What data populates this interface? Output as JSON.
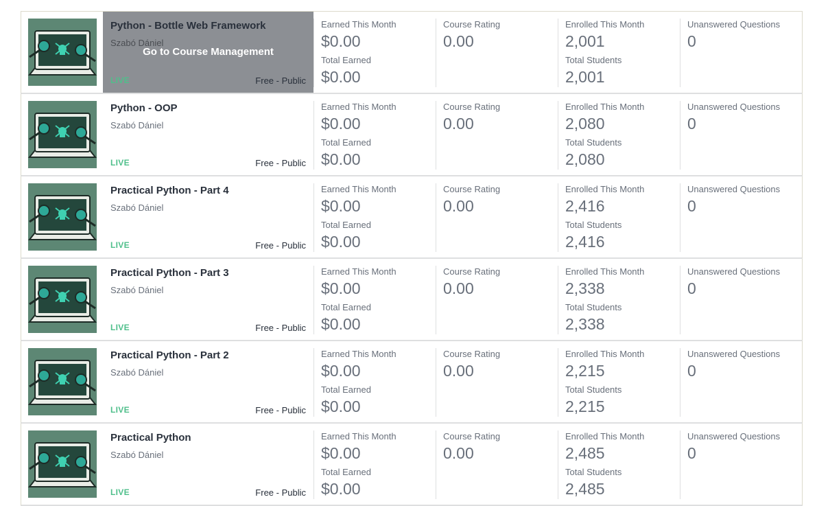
{
  "labels": {
    "earned_month": "Earned This Month",
    "total_earned": "Total Earned",
    "course_rating": "Course Rating",
    "enrolled_month": "Enrolled This Month",
    "total_students": "Total Students",
    "unanswered": "Unanswered Questions",
    "go_to_management": "Go to Course Management"
  },
  "colors": {
    "live": "#4fbf8b",
    "thumbnail_bg": "#5d8774",
    "hover_overlay": "#8c8f94"
  },
  "courses": [
    {
      "title": "Python - Bottle Web Framework",
      "author": "Szabó Dániel",
      "status": "LIVE",
      "visibility": "Free - Public",
      "earned_month": "$0.00",
      "total_earned": "$0.00",
      "rating": "0.00",
      "enrolled_month": "2,001",
      "total_students": "2,001",
      "unanswered": "0",
      "thumbnail_icon": "laptop-skull-icon"
    },
    {
      "title": "Python - OOP",
      "author": "Szabó Dániel",
      "status": "LIVE",
      "visibility": "Free - Public",
      "earned_month": "$0.00",
      "total_earned": "$0.00",
      "rating": "0.00",
      "enrolled_month": "2,080",
      "total_students": "2,080",
      "unanswered": "0",
      "thumbnail_icon": "laptop-skull-icon"
    },
    {
      "title": "Practical Python - Part 4",
      "author": "Szabó Dániel",
      "status": "LIVE",
      "visibility": "Free - Public",
      "earned_month": "$0.00",
      "total_earned": "$0.00",
      "rating": "0.00",
      "enrolled_month": "2,416",
      "total_students": "2,416",
      "unanswered": "0",
      "thumbnail_icon": "laptop-skull-icon"
    },
    {
      "title": "Practical Python - Part 3",
      "author": "Szabó Dániel",
      "status": "LIVE",
      "visibility": "Free - Public",
      "earned_month": "$0.00",
      "total_earned": "$0.00",
      "rating": "0.00",
      "enrolled_month": "2,338",
      "total_students": "2,338",
      "unanswered": "0",
      "thumbnail_icon": "laptop-skull-icon"
    },
    {
      "title": "Practical Python - Part 2",
      "author": "Szabó Dániel",
      "status": "LIVE",
      "visibility": "Free - Public",
      "earned_month": "$0.00",
      "total_earned": "$0.00",
      "rating": "0.00",
      "enrolled_month": "2,215",
      "total_students": "2,215",
      "unanswered": "0",
      "thumbnail_icon": "laptop-skull-icon"
    },
    {
      "title": "Practical Python",
      "author": "Szabó Dániel",
      "status": "LIVE",
      "visibility": "Free - Public",
      "earned_month": "$0.00",
      "total_earned": "$0.00",
      "rating": "0.00",
      "enrolled_month": "2,485",
      "total_students": "2,485",
      "unanswered": "0",
      "thumbnail_icon": "laptop-skull-icon"
    }
  ]
}
